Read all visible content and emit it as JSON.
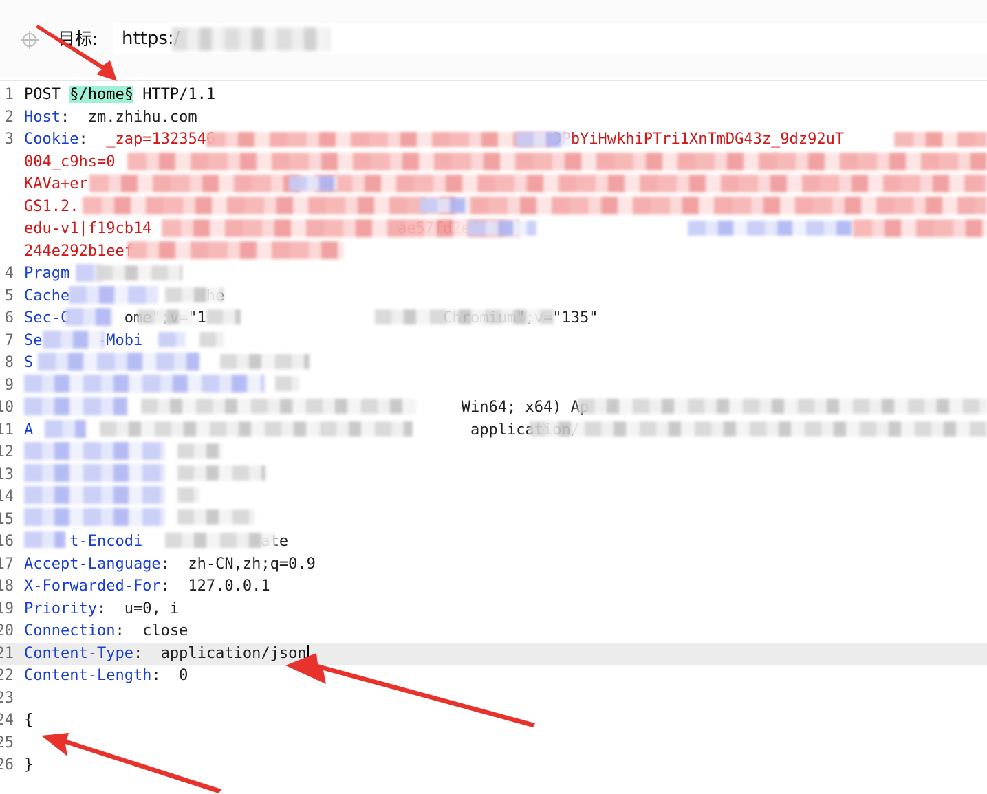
{
  "target": {
    "label": "目标:",
    "url": "https:/"
  },
  "request_lines": [
    {
      "n": "1",
      "parts": [
        [
          "m",
          "POST "
        ],
        [
          "sel",
          "§/home§"
        ],
        [
          "m",
          " HTTP/1.1"
        ]
      ]
    },
    {
      "n": "2",
      "parts": [
        [
          "k",
          "Host"
        ],
        [
          "v",
          ":  zm.zhihu.com"
        ]
      ]
    },
    {
      "n": "3",
      "parts": [
        [
          "k",
          "Cookie"
        ],
        [
          "v",
          ":  "
        ],
        [
          "r",
          "_zap=1323546"
        ],
        [
          "r",
          "                                     "
        ],
        [
          "r",
          "DPbYiHwkhiPTri1XnTmDG43z_9dz92uT"
        ]
      ]
    },
    {
      "n": "",
      "parts": [
        [
          "r",
          "004_c9hs=0"
        ]
      ]
    },
    {
      "n": "",
      "parts": [
        [
          "r",
          "KAVa+er"
        ]
      ]
    },
    {
      "n": "",
      "parts": [
        [
          "r",
          "GS1.2."
        ]
      ]
    },
    {
      "n": "",
      "parts": [
        [
          "r",
          "edu-v1|f19cb14"
        ],
        [
          "r",
          "                           "
        ],
        [
          "r",
          "ae57fd2ef70c"
        ]
      ]
    },
    {
      "n": "",
      "parts": [
        [
          "r",
          "244e292b1eef"
        ]
      ]
    },
    {
      "n": "4",
      "parts": [
        [
          "k",
          "Pragm"
        ]
      ]
    },
    {
      "n": "5",
      "parts": [
        [
          "k",
          "Cache"
        ],
        [
          "v",
          "               he"
        ]
      ]
    },
    {
      "n": "6",
      "parts": [
        [
          "k",
          "Sec-C"
        ],
        [
          "v",
          "      ome\";v=\"1"
        ],
        [
          "v",
          "                          Chromium\";v=\"135\""
        ]
      ]
    },
    {
      "n": "7",
      "parts": [
        [
          "k",
          "Se"
        ],
        [
          "k",
          "      -Mobi"
        ]
      ]
    },
    {
      "n": "8",
      "parts": [
        [
          "k",
          "S"
        ]
      ]
    },
    {
      "n": "9",
      "parts": [
        [
          "v",
          ""
        ]
      ]
    },
    {
      "n": "10",
      "parts": [
        [
          "v",
          "                                                Win64; x64) Ap"
        ]
      ]
    },
    {
      "n": "11",
      "parts": [
        [
          "k",
          "A"
        ],
        [
          "v",
          "                                                application/"
        ]
      ]
    },
    {
      "n": "12",
      "parts": [
        [
          "v",
          ""
        ]
      ]
    },
    {
      "n": "13",
      "parts": [
        [
          "v",
          ""
        ]
      ]
    },
    {
      "n": "14",
      "parts": [
        [
          "v",
          ""
        ]
      ]
    },
    {
      "n": "15",
      "parts": [
        [
          "v",
          ""
        ]
      ]
    },
    {
      "n": "16",
      "parts": [
        [
          "k",
          "     t-Encodi"
        ],
        [
          "v",
          "             ate"
        ]
      ]
    },
    {
      "n": "17",
      "parts": [
        [
          "k",
          "Accept-Language"
        ],
        [
          "v",
          ":  zh-CN,zh;q=0.9"
        ]
      ]
    },
    {
      "n": "18",
      "parts": [
        [
          "k",
          "X-Forwarded-For"
        ],
        [
          "v",
          ":  127.0.0.1"
        ]
      ]
    },
    {
      "n": "19",
      "parts": [
        [
          "k",
          "Priority"
        ],
        [
          "v",
          ":  u=0, i"
        ]
      ]
    },
    {
      "n": "20",
      "parts": [
        [
          "k",
          "Connection"
        ],
        [
          "v",
          ":  close"
        ]
      ]
    },
    {
      "n": "21",
      "parts": [
        [
          "k",
          "Content-Type"
        ],
        [
          "v",
          ":  application/json"
        ]
      ]
    },
    {
      "n": "22",
      "parts": [
        [
          "k",
          "Content-Length"
        ],
        [
          "v",
          ":  0"
        ]
      ]
    },
    {
      "n": "23",
      "parts": [
        [
          "v",
          ""
        ]
      ]
    },
    {
      "n": "24",
      "parts": [
        [
          "m",
          "{"
        ]
      ]
    },
    {
      "n": "25",
      "parts": [
        [
          "v",
          ""
        ]
      ]
    },
    {
      "n": "26",
      "parts": [
        [
          "m",
          "}"
        ]
      ]
    }
  ],
  "current_line": "21"
}
